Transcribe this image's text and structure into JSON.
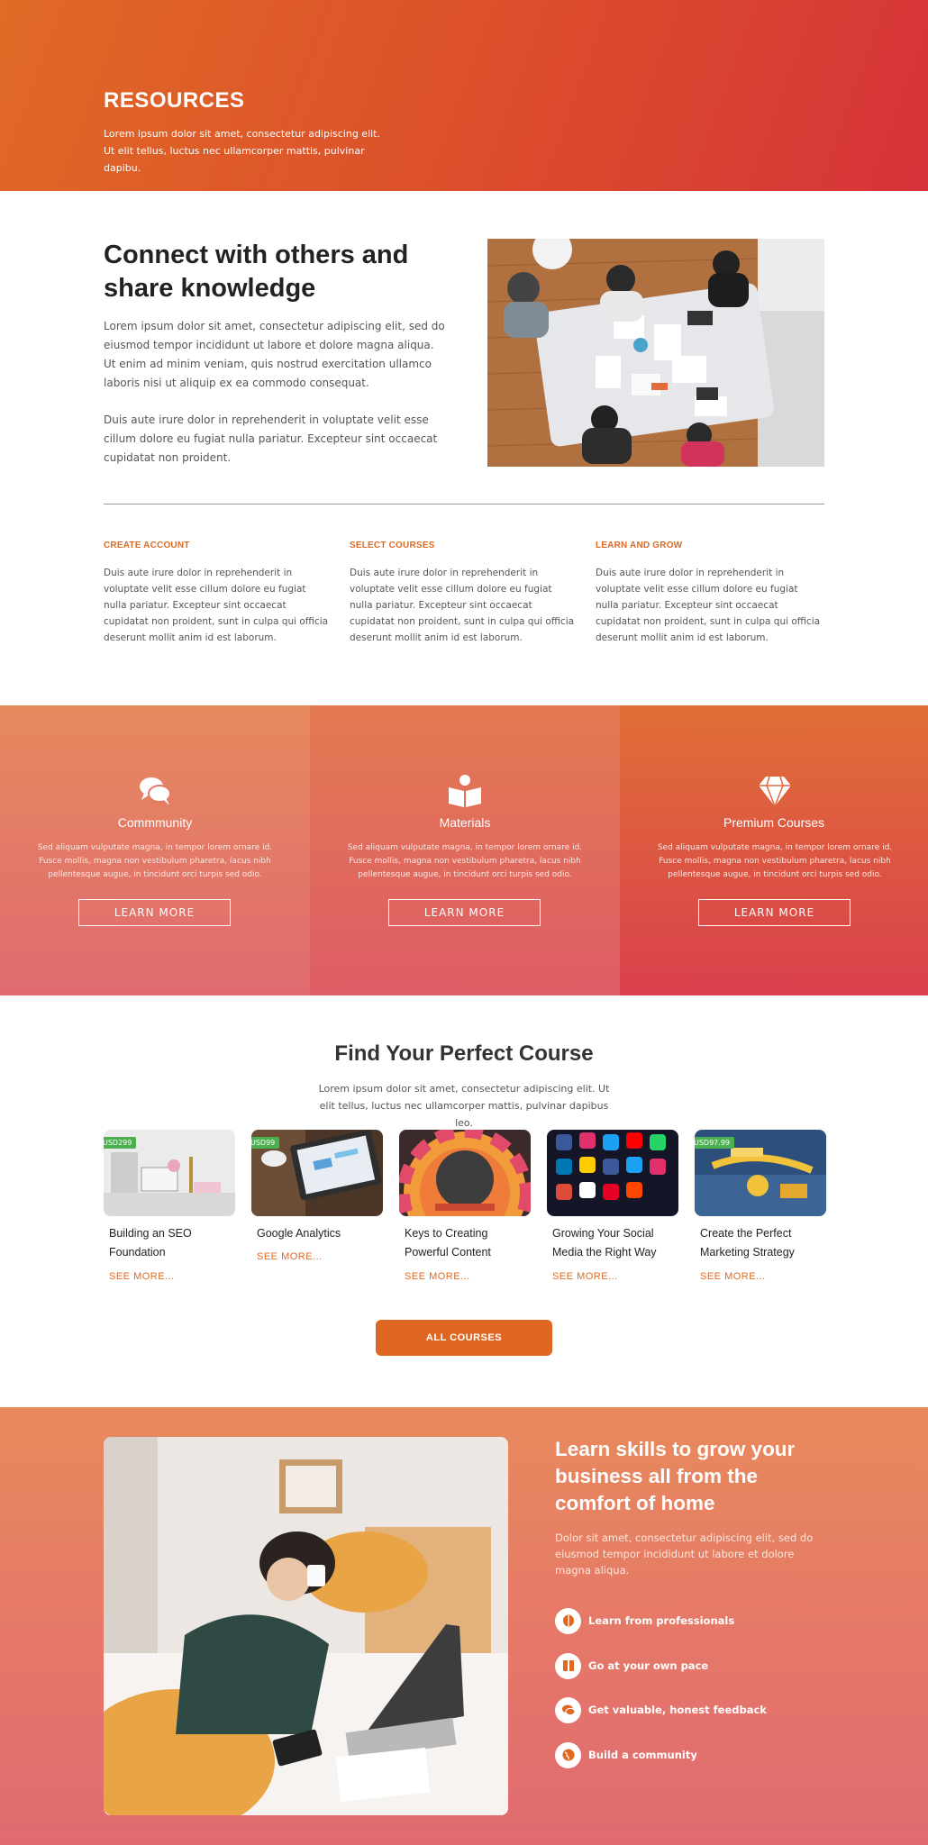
{
  "hero": {
    "title": "RESOURCES",
    "subtitle": "Lorem ipsum dolor sit amet, consectetur adipiscing elit. Ut elit tellus, luctus nec ullamcorper mattis, pulvinar dapibu."
  },
  "connect": {
    "title": "Connect with others and share knowledge",
    "paragraph1": "Lorem ipsum dolor sit amet, consectetur adipiscing elit, sed do eiusmod tempor incididunt ut labore et dolore magna aliqua. Ut enim ad minim veniam, quis nostrud exercitation ullamco laboris nisi ut aliquip ex ea commodo consequat.",
    "paragraph2": "Duis aute irure dolor in reprehenderit in voluptate velit esse cillum dolore eu fugiat nulla pariatur. Excepteur sint occaecat cupidatat non proident."
  },
  "steps": [
    {
      "title": "CREATE ACCOUNT",
      "text": "Duis aute irure dolor in reprehenderit in voluptate velit esse cillum dolore eu fugiat nulla pariatur. Excepteur sint occaecat cupidatat non proident, sunt in culpa qui officia deserunt mollit anim id est laborum."
    },
    {
      "title": "SELECT COURSES",
      "text": "Duis aute irure dolor in reprehenderit in voluptate velit esse cillum dolore eu fugiat nulla pariatur. Excepteur sint occaecat cupidatat non proident, sunt in culpa qui officia deserunt mollit anim id est laborum."
    },
    {
      "title": "LEARN AND GROW",
      "text": "Duis aute irure dolor in reprehenderit in voluptate velit esse cillum dolore eu fugiat nulla pariatur. Excepteur sint occaecat cupidatat non proident, sunt in culpa qui officia deserunt mollit anim id est laborum."
    }
  ],
  "features": [
    {
      "icon": "chat-bubbles-icon",
      "title": "Commmunity",
      "text": "Sed aliquam vulputate magna, in tempor lorem ornare id. Fusce mollis, magna non vestibulum pharetra, lacus nibh pellentesque augue, in tincidunt orci turpis sed odio.",
      "button": "LEARN MORE"
    },
    {
      "icon": "open-book-reader-icon",
      "title": "Materials",
      "text": "Sed aliquam vulputate magna, in tempor lorem ornare id. Fusce mollis, magna non vestibulum pharetra, lacus nibh pellentesque augue, in tincidunt orci turpis sed odio.",
      "button": "LEARN MORE"
    },
    {
      "icon": "diamond-icon",
      "title": "Premium Courses",
      "text": "Sed aliquam vulputate magna, in tempor lorem ornare id. Fusce mollis, magna non vestibulum pharetra, lacus nibh pellentesque augue, in tincidunt orci turpis sed odio.",
      "button": "LEARN MORE"
    }
  ],
  "find": {
    "title": "Find Your Perfect Course",
    "subtitle": "Lorem ipsum dolor sit amet, consectetur adipiscing elit. Ut elit tellus, luctus nec ullamcorper mattis, pulvinar dapibus leo.",
    "all_courses": "ALL COURSES"
  },
  "courses": [
    {
      "badge": "USD299",
      "title": "Building an SEO Foundation",
      "more": "SEE MORE..."
    },
    {
      "badge": "USD99",
      "title": "Google Analytics",
      "more": "SEE MORE..."
    },
    {
      "badge": "",
      "title": "Keys to Creating Powerful Content",
      "more": "SEE MORE..."
    },
    {
      "badge": "",
      "title": "Growing Your Social Media the Right Way",
      "more": "SEE MORE..."
    },
    {
      "badge": "USD97.99",
      "title": "Create the Perfect Marketing Strategy",
      "more": "SEE MORE..."
    }
  ],
  "bottom": {
    "title": "Learn skills to grow your business all from the comfort of home",
    "text": "Dolor sit amet, consectetur adipiscing elit, sed do eiusmod tempor incididunt ut labore et dolore magna aliqua.",
    "items": [
      {
        "icon": "brain-icon",
        "label": "Learn from professionals"
      },
      {
        "icon": "pause-icon",
        "label": "Go at your own pace"
      },
      {
        "icon": "chat-icon",
        "label": "Get valuable, honest feedback"
      },
      {
        "icon": "globe-icon",
        "label": "Build a community"
      }
    ]
  },
  "colors": {
    "accent": "#e06722",
    "badge_green": "#4cb050",
    "hero_start": "#e06a26",
    "hero_end": "#d6333a"
  }
}
